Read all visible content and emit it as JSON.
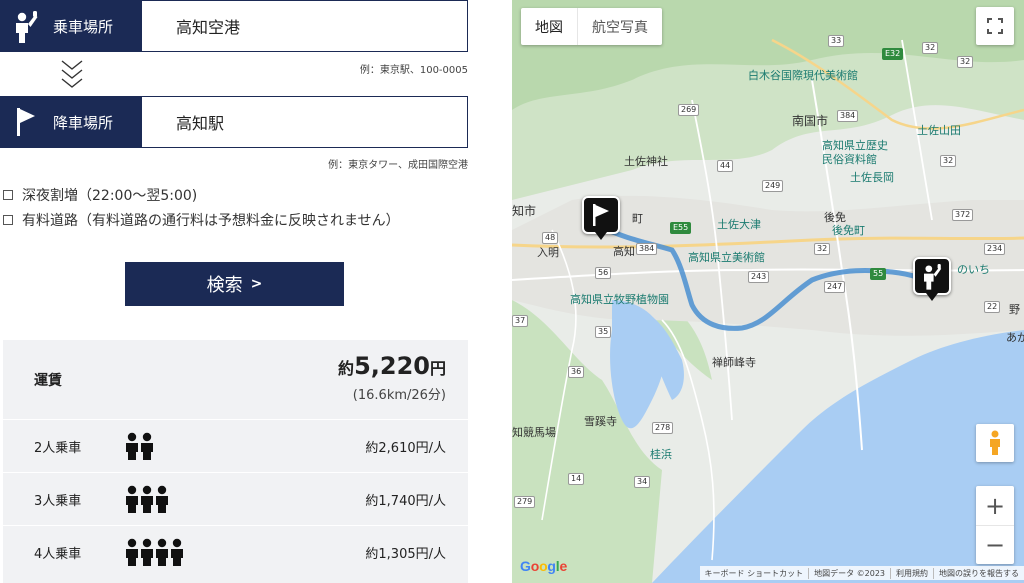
{
  "form": {
    "pickup": {
      "label": "乗車場所",
      "value": "高知空港",
      "example": "例：東京駅、100-0005"
    },
    "dropoff": {
      "label": "降車場所",
      "value": "高知駅",
      "example": "例：東京タワー、成田国際空港"
    },
    "options": [
      {
        "label": "深夜割増（22:00〜翌5:00)"
      },
      {
        "label": "有料道路（有料道路の通行料は予想料金に反映されません）"
      }
    ],
    "search_label": "検索",
    "search_arrow": ">"
  },
  "fare": {
    "label": "運賃",
    "prefix": "約",
    "amount": "5,220",
    "unit": "円",
    "detail": "(16.6km/26分)",
    "per_person": [
      {
        "label": "2人乗車",
        "people": 2,
        "value": "約2,610円/人"
      },
      {
        "label": "3人乗車",
        "people": 3,
        "value": "約1,740円/人"
      },
      {
        "label": "4人乗車",
        "people": 4,
        "value": "約1,305円/人"
      }
    ]
  },
  "map": {
    "type_buttons": [
      "地図",
      "航空写真"
    ],
    "zoom_in": "+",
    "zoom_out": "−",
    "google_logo": "Google",
    "attribution": [
      "キーボード ショートカット",
      "地図データ ©2023",
      "利用規約",
      "地図の誤りを報告する"
    ],
    "places": {
      "museum_shirakiya": "白木谷国際現代美術館",
      "nankoku": "南国市",
      "tosa_yamada": "土佐山田",
      "kochi_history": "高知県立歴史",
      "folk_museum": "民俗資料館",
      "tosa_shrine": "土佐神社",
      "tosa_nagaoka": "土佐長岡",
      "tosa_otsu": "土佐大津",
      "gomen": "後免",
      "gomen_station": "後免町",
      "kochi_art": "高知県立美術館",
      "kochi_city": "知市",
      "kochi_sta": "高知",
      "makino_garden": "高知県立牧野植物園",
      "iri": "入明",
      "shinzanji": "禅師峰寺",
      "sekkeiji": "雪蹊寺",
      "katsurahama": "桂浜",
      "keibajo": "知競馬場",
      "noichi": "のいち",
      "no": "野",
      "aka": "あか",
      "machi": "町"
    },
    "road_numbers": [
      "33",
      "E32",
      "32",
      "269",
      "384",
      "44",
      "249",
      "32",
      "E55",
      "48",
      "56",
      "384",
      "32",
      "243",
      "247",
      "55",
      "372",
      "234",
      "22",
      "35",
      "37",
      "36",
      "278",
      "14",
      "34",
      "279",
      "32"
    ]
  },
  "colors": {
    "navy": "#1b2a55",
    "fare_bg": "#f1f2f4",
    "route": "#5a9bd5",
    "sea": "#a9cdf3",
    "land": "#e8ecea",
    "park": "#c8e6c0"
  }
}
